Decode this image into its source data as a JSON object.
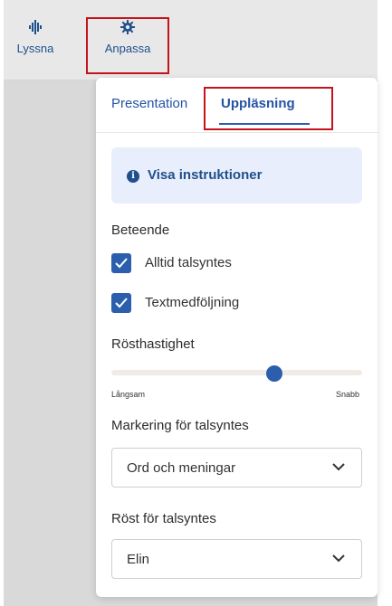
{
  "toolbar": {
    "listen": {
      "label": "Lyssna",
      "icon": "sound-wave-icon"
    },
    "customize": {
      "label": "Anpassa",
      "icon": "gear-icon"
    }
  },
  "panel": {
    "tabs": [
      {
        "label": "Presentation",
        "active": false
      },
      {
        "label": "Uppläsning",
        "active": true
      }
    ],
    "instructions_button": {
      "label": "Visa instruktioner",
      "icon": "info-icon"
    },
    "behavior": {
      "title": "Beteende",
      "options": [
        {
          "label": "Alltid talsyntes",
          "checked": true
        },
        {
          "label": "Textmedföljning",
          "checked": true
        }
      ]
    },
    "speed": {
      "title": "Rösthastighet",
      "min_label": "Långsam",
      "max_label": "Snabb",
      "value_fraction": 0.65
    },
    "highlighting": {
      "title": "Markering för talsyntes",
      "selected": "Ord och meningar"
    },
    "voice": {
      "title": "Röst för talsyntes",
      "selected": "Elin"
    }
  },
  "colors": {
    "accent": "#2b5fae",
    "link": "#1f4f8c",
    "highlight_box": "#c6131b",
    "info_bg": "#e8eefb"
  }
}
